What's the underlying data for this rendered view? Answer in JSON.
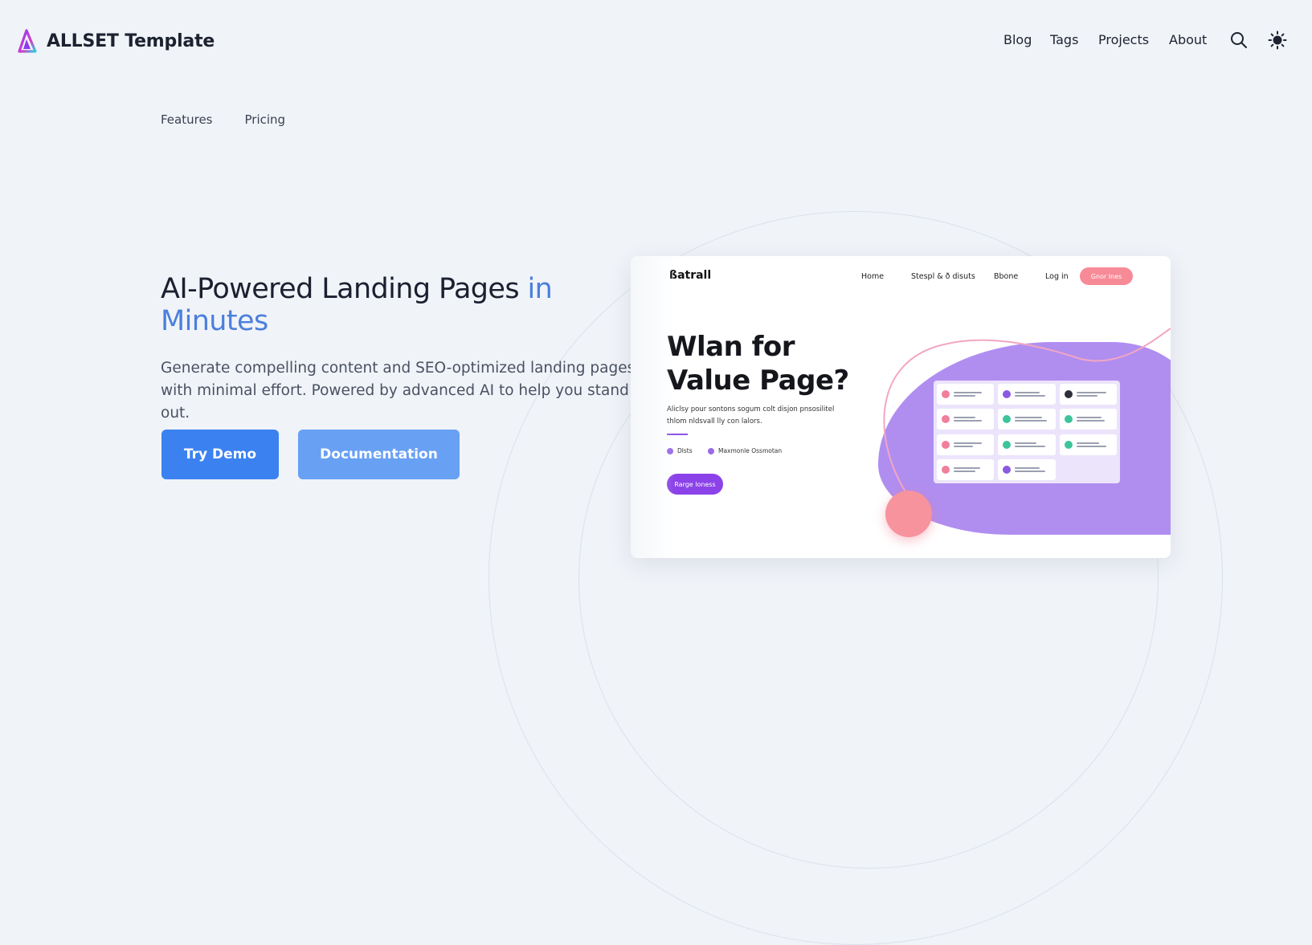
{
  "brand": {
    "name": "ALLSET Template"
  },
  "nav": {
    "blog": "Blog",
    "tags": "Tags",
    "projects": "Projects",
    "about": "About"
  },
  "icons": {
    "logo": "triangle-logo-icon",
    "search": "search-icon",
    "theme": "sun-icon"
  },
  "subnav": {
    "features": "Features",
    "pricing": "Pricing"
  },
  "hero": {
    "title_main": "AI-Powered Landing Pages",
    "title_accent": "in Minutes",
    "description": "Generate compelling content and SEO-optimized landing pages with minimal effort. Powered by advanced AI to help you stand out.",
    "try_demo": "Try Demo",
    "documentation": "Documentation"
  },
  "colors": {
    "accent": "#4a7fdc",
    "primary_button": "#3b82f0",
    "secondary_button": "#68a0f4",
    "background": "#f0f3f8"
  },
  "mockup": {
    "logo": "ßatrall",
    "nav": [
      "Home",
      "Stespl & ð disuts",
      "Bbone",
      "Log in"
    ],
    "cta": "Gnor lnes",
    "heading_line1": "Wlan for",
    "heading_line2": "Value Page?",
    "paragraph": "Aliclsy pour sontons sogum colt disjon pnsosilitel thlom nldsvall lly con lalors.",
    "tag1": "Dlsts",
    "tag2": "Maxmonle Ossmotan",
    "button": "Rarge loness"
  }
}
